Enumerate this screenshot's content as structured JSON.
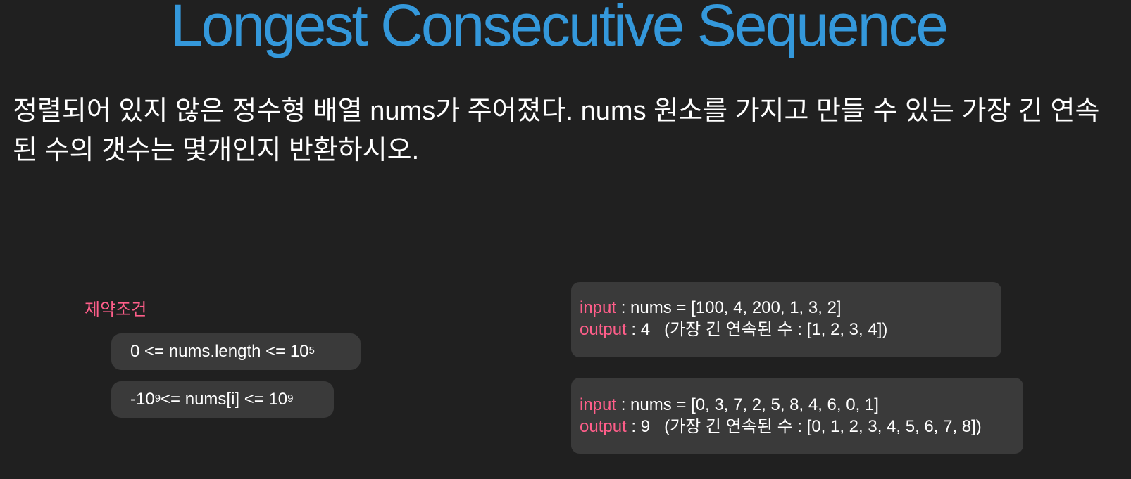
{
  "title": "Longest Consecutive Sequence",
  "description": "정렬되어 있지 않은 정수형 배열 nums가 주어졌다. nums 원소를 가지고 만들 수 있는 가장 긴 연속된 수의 갯수는 몇개인지 반환하시오.",
  "constraints": {
    "label": "제약조건",
    "items": [
      {
        "prefix": "0 <= nums.length <= 10",
        "sup": "5",
        "suffix": ""
      },
      {
        "prefix": "-10",
        "sup": "9",
        "middle": " <= nums[i] <= 10",
        "sup2": "9"
      }
    ]
  },
  "examples": [
    {
      "input_label": "input",
      "input_value": " : nums = [100, 4, 200, 1, 3, 2]",
      "output_label": "output",
      "output_value": " : 4   (가장 긴 연속된 수 : [1, 2, 3, 4])"
    },
    {
      "input_label": "input",
      "input_value": " : nums = [0, 3, 7, 2, 5, 8, 4, 6, 0, 1]",
      "output_label": "output",
      "output_value": " : 9   (가장 긴 연속된 수 : [0, 1, 2, 3, 4, 5, 6, 7, 8])"
    }
  ],
  "colors": {
    "background": "#202020",
    "title": "#3498db",
    "keyword": "#ff5e8a",
    "card": "#3a3a3a"
  }
}
